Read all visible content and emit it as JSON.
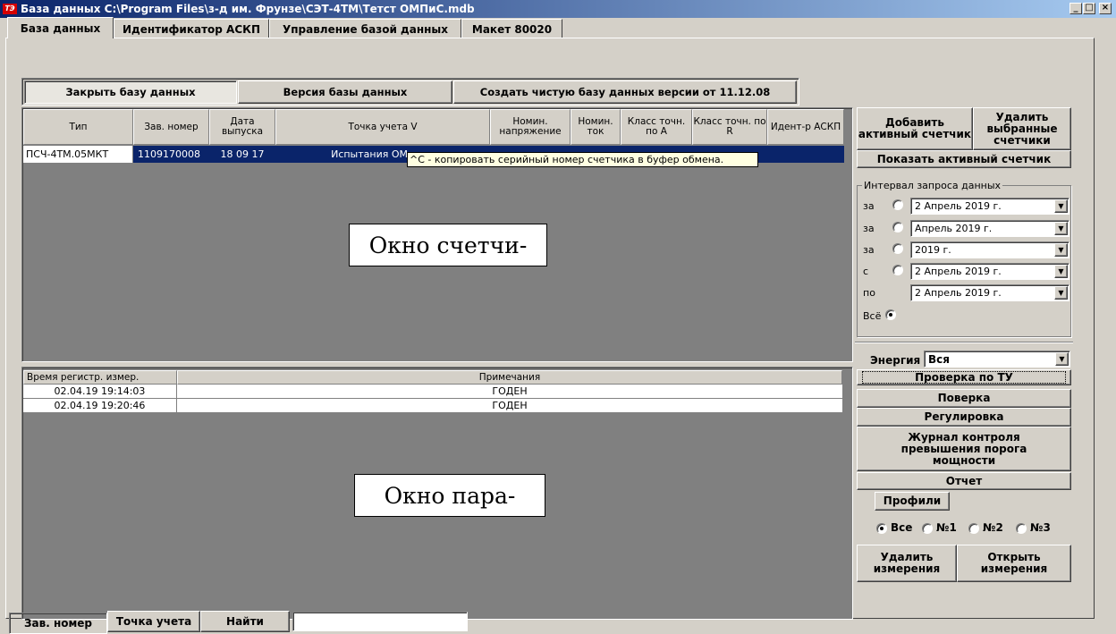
{
  "window": {
    "title": "База данных C:\\Program Files\\з-д им. Фрунзе\\СЭТ-4ТМ\\Тетст ОМПиС.mdb",
    "icon_label": "ТЭ",
    "minimize": "_",
    "maximize": "□",
    "close": "×"
  },
  "tabs": [
    "База данных",
    "Идентификатор АСКП",
    "Управление базой данных",
    "Макет 80020"
  ],
  "toolbar": {
    "close_db": "Закрыть базу данных",
    "db_version": "Версия базы данных",
    "create_db": "Создать чистую базу данных версии от 11.12.08"
  },
  "meters_table": {
    "headers": [
      "Тип",
      "Зав. номер",
      "Дата выпуска",
      "Точка учета V",
      "Номин. напряжение",
      "Номин. ток",
      "Класс точн. по А",
      "Класс точн. по R",
      "Идент-р АСКП"
    ],
    "row": {
      "type": "ПСЧ-4ТМ.05МКТ",
      "serial": "1109170008",
      "date": "18 09 17",
      "point": "Испытания ОМ"
    },
    "tooltip": "^C - копировать серийный номер счетчика в буфер обмена."
  },
  "callout_meters": "Окно счетчи-",
  "measurements_table": {
    "headers": [
      "Время регистр. измер.",
      "Примечания"
    ],
    "rows": [
      {
        "time": "02.04.19 19:14:03",
        "note": "ГОДЕН"
      },
      {
        "time": "02.04.19 19:20:46",
        "note": "ГОДЕН"
      }
    ]
  },
  "callout_params": "Окно пара-",
  "right_panel": {
    "add_active": "Добавить активный счетчик",
    "delete_selected": "Удалить выбранные счетчики",
    "show_active": "Показать активный счетчик",
    "interval_title": "Интервал запроса данных",
    "rows": [
      {
        "label": "за",
        "value": "2  Апрель  2019 г."
      },
      {
        "label": "за",
        "value": "Апрель  2019 г."
      },
      {
        "label": "за",
        "value": "2019 г."
      },
      {
        "label": "с",
        "value": "2  Апрель  2019 г."
      },
      {
        "label": "по",
        "value": "2  Апрель  2019 г."
      }
    ],
    "all_label": "Всё",
    "energy_label": "Энергия",
    "energy_value": "Вся",
    "check_tu": "Проверка по ТУ",
    "verification": "Поверка",
    "regulation": "Регулировка",
    "journal": "Журнал контроля превышения порога мощности",
    "report": "Отчет",
    "profiles": "Профили",
    "profile_options": [
      "Все",
      "№1",
      "№2",
      "№3"
    ],
    "delete_measurements": "Удалить измерения",
    "open_measurements": "Открыть измерения"
  },
  "bottom": {
    "serial_tab": "Зав. номер",
    "point_tab": "Точка учета",
    "find": "Найти",
    "search_value": ""
  }
}
